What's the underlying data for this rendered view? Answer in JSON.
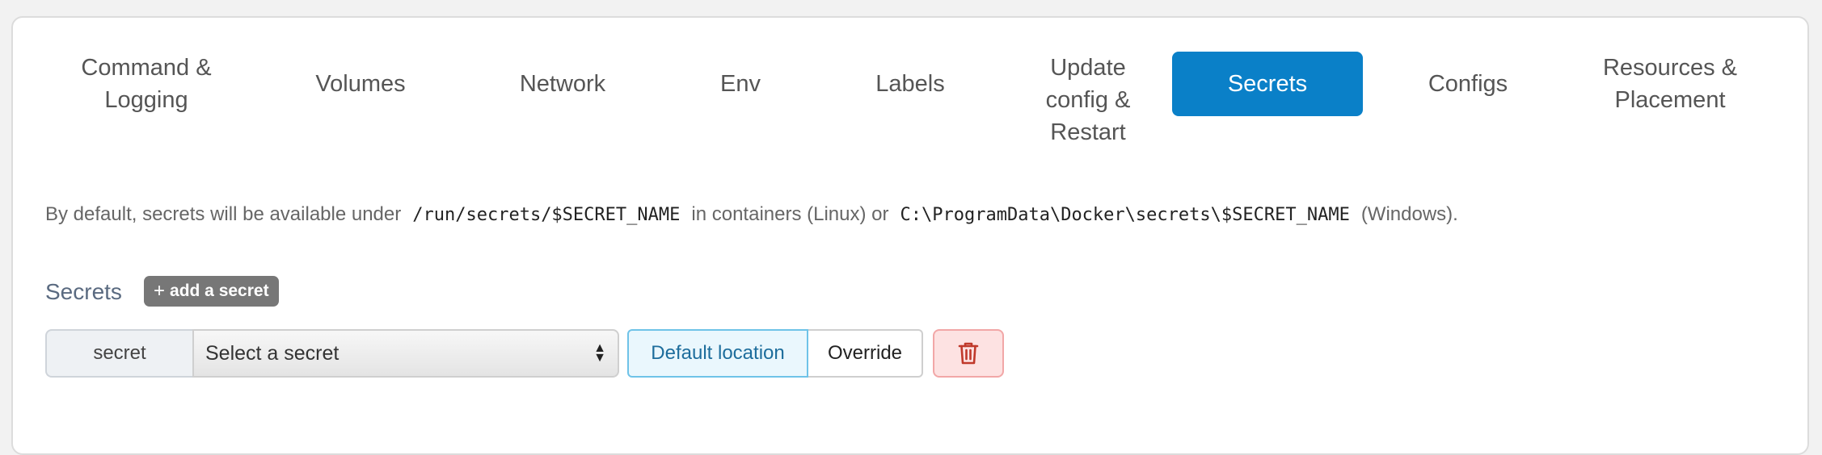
{
  "tabs": [
    {
      "lines": [
        "Command &",
        "Logging"
      ]
    },
    {
      "lines": [
        "Volumes"
      ]
    },
    {
      "lines": [
        "Network"
      ]
    },
    {
      "lines": [
        "Env"
      ]
    },
    {
      "lines": [
        "Labels"
      ]
    },
    {
      "lines": [
        "Update",
        "config &",
        "Restart"
      ]
    },
    {
      "lines": [
        "Secrets"
      ],
      "active": true
    },
    {
      "lines": [
        "Configs"
      ]
    },
    {
      "lines": [
        "Resources &",
        "Placement"
      ]
    }
  ],
  "info": {
    "prefix": "By default, secrets will be available under",
    "linux_path": "/run/secrets/$SECRET_NAME",
    "middle": "in containers (Linux) or",
    "windows_path": "C:\\ProgramData\\Docker\\secrets\\$SECRET_NAME",
    "suffix": "(Windows)."
  },
  "secrets": {
    "label": "Secrets",
    "add_label": "add a secret",
    "add_icon": "plus-icon",
    "row": {
      "addon": "secret",
      "select_value": "Select a secret",
      "location_default": "Default location",
      "location_override": "Override",
      "delete_icon": "trash-icon"
    }
  },
  "colors": {
    "accent": "#0a80c8",
    "danger_bg": "#fde2e2",
    "danger_icon": "#c0392b"
  }
}
